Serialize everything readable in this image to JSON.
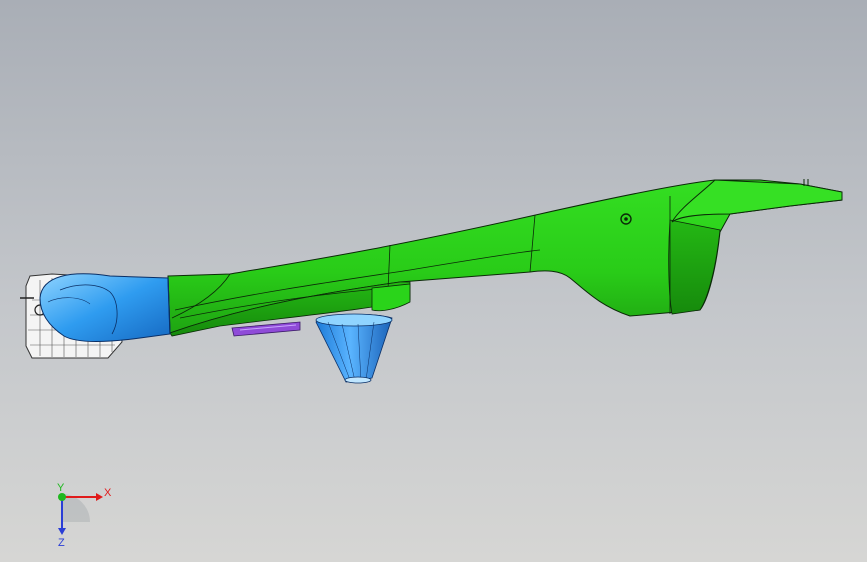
{
  "viewport": {
    "colors": {
      "background_top": "#a9aeb6",
      "background_bottom": "#d6d6d4",
      "part_green": "#2bd21b",
      "part_blue": "#2f9cf0",
      "part_purple": "#8f4bd8",
      "edge": "#0b2a08"
    }
  },
  "triad": {
    "x_label": "X",
    "y_label": "Y",
    "z_label": "Z",
    "x_color": "#e01b1b",
    "y_color": "#1fb81f",
    "z_color": "#2a3ed6"
  }
}
